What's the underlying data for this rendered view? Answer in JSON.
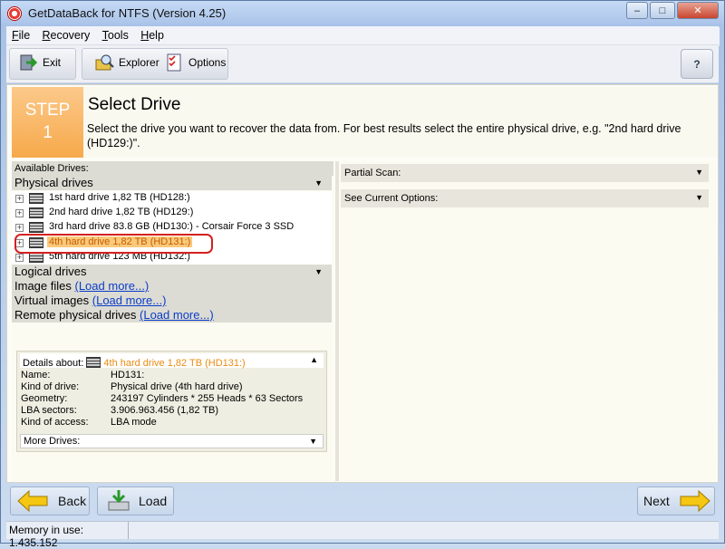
{
  "window": {
    "title": "GetDataBack for NTFS (Version 4.25)"
  },
  "menu": [
    "File",
    "Recovery",
    "Tools",
    "Help"
  ],
  "menu_underline": [
    "F",
    "R",
    "T",
    "H"
  ],
  "toolbar": {
    "exit_label": "Exit",
    "explorer_label": "Explorer",
    "options_label": "Options"
  },
  "step": {
    "label": "STEP",
    "number": "1",
    "title": "Select Drive",
    "description": "Select the drive you want to recover the data from. For best results select the entire physical drive, e.g. \"2nd hard drive (HD129:)\"."
  },
  "drives": {
    "available_label": "Available Drives:",
    "physical_header": "Physical drives",
    "items": [
      "1st hard drive 1,82 TB (HD128:)",
      "2nd hard drive 1,82 TB (HD129:)",
      "3rd hard drive 83.8 GB (HD130:) - Corsair Force 3 SSD",
      "4th hard drive 1,82 TB (HD131:)",
      "5th hard drive 123 MB (HD132:)"
    ],
    "selected_index": 3,
    "logical_header": "Logical drives",
    "image_files": "Image files",
    "virtual_images": "Virtual images",
    "remote_drives": "Remote physical drives",
    "load_more": "(Load more...)"
  },
  "details": {
    "header_label": "Details about:",
    "selected": "4th hard drive 1,82 TB (HD131:)",
    "rows": [
      {
        "key": "Name:",
        "value": "HD131:"
      },
      {
        "key": "Kind of drive:",
        "value": "Physical drive (4th hard drive)"
      },
      {
        "key": "Geometry:",
        "value": "243197 Cylinders * 255 Heads * 63 Sectors"
      },
      {
        "key": "LBA sectors:",
        "value": "3.906.963.456 (1,82 TB)"
      },
      {
        "key": "Kind of access:",
        "value": "LBA mode"
      }
    ],
    "more_drives": "More Drives:"
  },
  "right": {
    "partial_scan": "Partial Scan:",
    "current_options": "See Current Options:"
  },
  "nav": {
    "back": "Back",
    "load": "Load",
    "next": "Next"
  },
  "status": {
    "memory": "Memory in use: 1.435.152"
  }
}
